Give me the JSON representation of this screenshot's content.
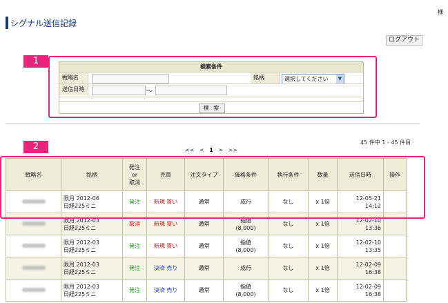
{
  "header": {
    "title": "シグナル送信記録",
    "user_suffix": "様",
    "logout_label": "ログアウト"
  },
  "badges": {
    "one": "1",
    "two": "2"
  },
  "search": {
    "heading": "検索条件",
    "strategy_label": "戦略名",
    "symbol_label": "銘柄",
    "symbol_select": "選択してください",
    "date_label": "送信日時",
    "date_sep": "～",
    "button": "検 索"
  },
  "pagination": {
    "count": "45 件中 1 - 45 件目",
    "first": "<<",
    "prev": "<",
    "current": "1",
    "next": ">",
    "last": ">>"
  },
  "table": {
    "headers": [
      "戦略名",
      "銘柄",
      "発注\nor\n取消",
      "売買",
      "注文タイプ",
      "価格条件",
      "執行条件",
      "数量",
      "送信日時",
      "操作"
    ],
    "rows": [
      {
        "symbol1": "限月 2012-06",
        "symbol2": "日経225ミニ",
        "order": "発注",
        "order_color": "green",
        "side": "新規 買い",
        "side_color": "red",
        "type": "通常",
        "price1": "成行",
        "price2": "",
        "exec": "なし",
        "qty": "x 1倍",
        "date": "12-05-21",
        "time": "14:12"
      },
      {
        "symbol1": "限月 2012-03",
        "symbol2": "日経225ミニ",
        "order": "取消",
        "order_color": "red",
        "side": "新規 買い",
        "side_color": "red",
        "type": "通常",
        "price1": "指値",
        "price2": "(8,000)",
        "exec": "なし",
        "qty": "x 1倍",
        "date": "12-02-10",
        "time": "13:36"
      },
      {
        "symbol1": "限月 2012-03",
        "symbol2": "日経225ミニ",
        "order": "発注",
        "order_color": "green",
        "side": "新規 買い",
        "side_color": "red",
        "type": "通常",
        "price1": "指値",
        "price2": "(8,000)",
        "exec": "なし",
        "qty": "x 1倍",
        "date": "12-02-10",
        "time": "13:35"
      },
      {
        "symbol1": "限月 2012-03",
        "symbol2": "日経225ミニ",
        "order": "発注",
        "order_color": "green",
        "side": "決済 売り",
        "side_color": "blue",
        "type": "通常",
        "price1": "成行",
        "price2": "",
        "exec": "なし",
        "qty": "x 1倍",
        "date": "12-02-09",
        "time": "16:38"
      },
      {
        "symbol1": "限月 2012-03",
        "symbol2": "日経225ミニ",
        "order": "発注",
        "order_color": "green",
        "side": "決済 売り",
        "side_color": "blue",
        "type": "通常",
        "price1": "指値",
        "price2": "(8,000)",
        "exec": "なし",
        "qty": "x 1倍",
        "date": "12-02-09",
        "time": "16:38"
      }
    ]
  },
  "colors": {
    "accent": "#e8257a",
    "title": "#1d3a7a",
    "green": "#1a9a1a",
    "red": "#d01818",
    "blue": "#1a3ccc"
  }
}
